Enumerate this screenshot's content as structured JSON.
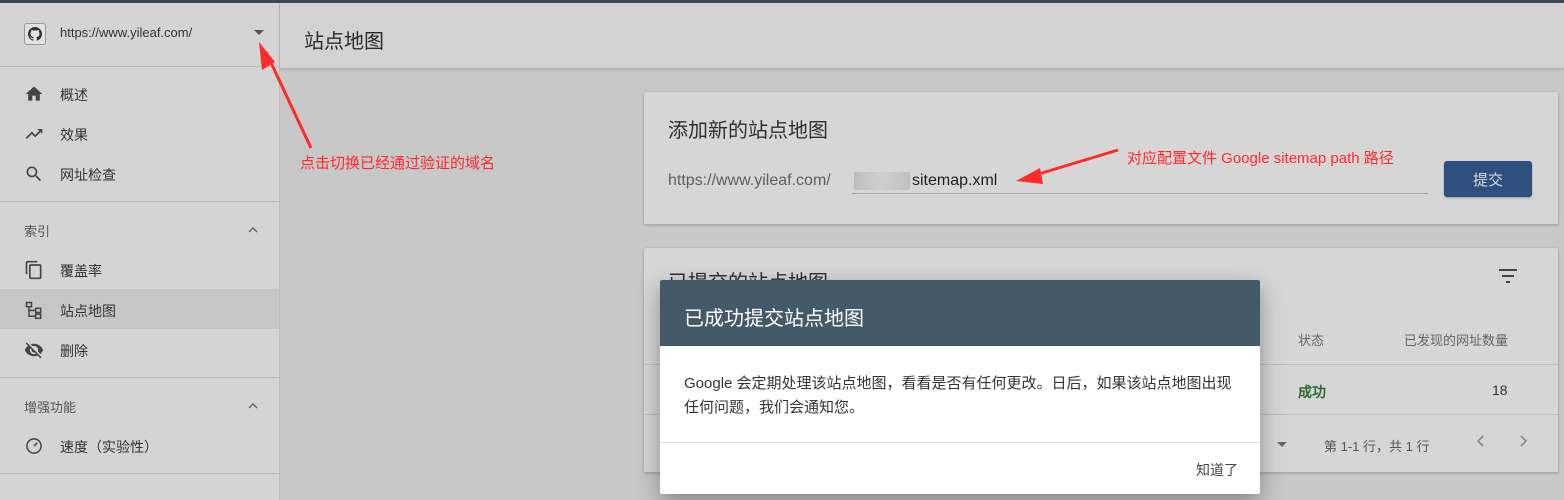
{
  "property": {
    "url": "https://www.yileaf.com/",
    "icon": "github-icon"
  },
  "sidebar": {
    "items_top": [
      {
        "label": "概述",
        "icon": "home-icon"
      },
      {
        "label": "效果",
        "icon": "trending-up-icon"
      },
      {
        "label": "网址检查",
        "icon": "search-icon"
      }
    ],
    "section_index": {
      "label": "索引"
    },
    "items_index": [
      {
        "label": "覆盖率",
        "icon": "copy-icon"
      },
      {
        "label": "站点地图",
        "icon": "sitemap-icon"
      },
      {
        "label": "删除",
        "icon": "eye-off-icon"
      }
    ],
    "section_enhance": {
      "label": "增强功能"
    },
    "items_enhance": [
      {
        "label": "速度（实验性）",
        "icon": "speed-icon"
      }
    ]
  },
  "header": {
    "title": "站点地图"
  },
  "add_card": {
    "title": "添加新的站点地图",
    "prefix": "https://www.yileaf.com/",
    "input_value": "sitemap.xml",
    "submit_label": "提交"
  },
  "submitted_card": {
    "title": "已提交的站点地图",
    "col_status": "状态",
    "col_discovered": "已发现的网址数量",
    "row_status": "成功",
    "row_count": "18",
    "pagination": "第 1-1 行，共 1 行"
  },
  "annotations": {
    "left": "点击切换已经通过验证的域名",
    "right": "对应配置文件 Google sitemap path 路径"
  },
  "dialog": {
    "title": "已成功提交站点地图",
    "body": "Google 会定期处理该站点地图，看看是否有任何更改。日后，如果该站点地图出现任何问题，我们会通知您。",
    "button": "知道了"
  },
  "colors": {
    "annotation": "#ff2a2a",
    "dialog_header": "#455a68",
    "submit_button": "#2f4f7f",
    "success": "#2b6a36"
  }
}
